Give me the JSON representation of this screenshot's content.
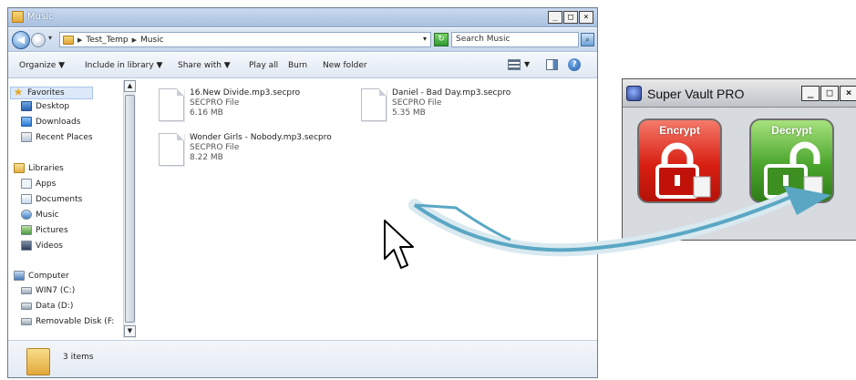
{
  "explorer": {
    "title": "Music",
    "window_controls": [
      "_",
      "□",
      "×"
    ],
    "breadcrumb": [
      "Test_Temp",
      "Music"
    ],
    "search_placeholder": "Search Music",
    "toolbar": {
      "organize": "Organize ▼",
      "include": "Include in library ▼",
      "share": "Share with ▼",
      "play_all": "Play all",
      "burn": "Burn",
      "new_folder": "New folder"
    },
    "nav": {
      "favorites": "Favorites",
      "desktop": "Desktop",
      "downloads": "Downloads",
      "recent": "Recent Places",
      "libraries": "Libraries",
      "apps": "Apps",
      "documents": "Documents",
      "music": "Music",
      "pictures": "Pictures",
      "videos": "Videos",
      "computer": "Computer",
      "win7": "WIN7 (C:)",
      "data": "Data (D:)",
      "removable": "Removable Disk (F:"
    },
    "files": [
      {
        "name": "16.New Divide.mp3.secpro",
        "type": "SECPRO File",
        "size": "6.16 MB"
      },
      {
        "name": "Daniel - Bad Day.mp3.secpro",
        "type": "SECPRO File",
        "size": "5.35 MB"
      },
      {
        "name": "Wonder Girls - Nobody.mp3.secpro",
        "type": "SECPRO File",
        "size": "8.22 MB"
      }
    ],
    "status": "3 items"
  },
  "vault": {
    "title": "Super Vault PRO",
    "controls": [
      "_",
      "□",
      "×"
    ],
    "encrypt_label": "Encrypt",
    "decrypt_label": "Decrypt"
  },
  "colors": {
    "encrypt": "#d81f12",
    "decrypt": "#4aa52c",
    "arrow": "#5aa7c4"
  }
}
